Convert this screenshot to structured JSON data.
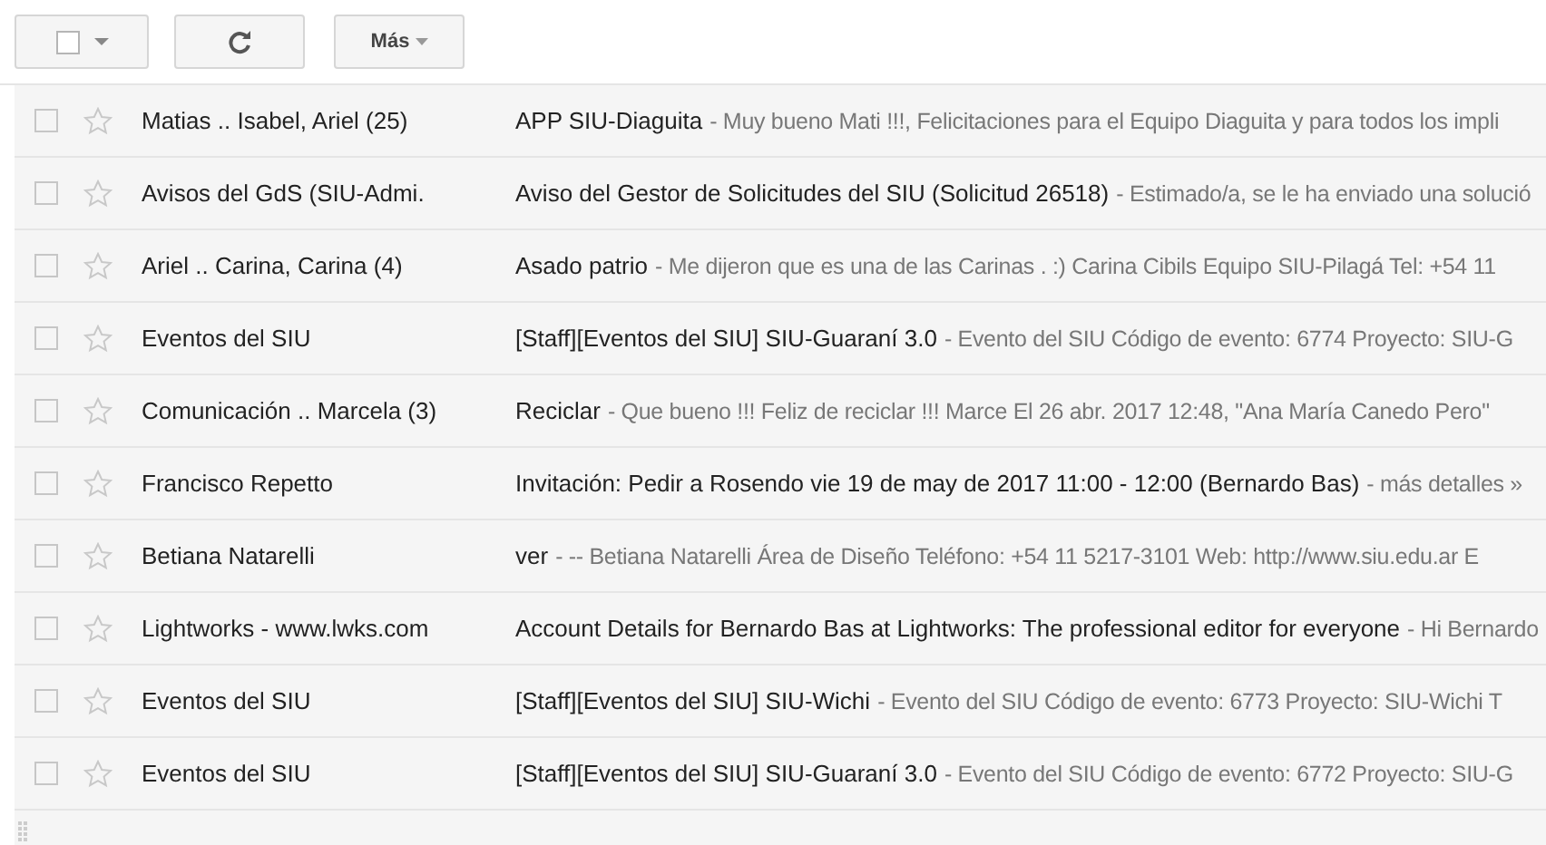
{
  "toolbar": {
    "select": {
      "checked": false
    },
    "more_label": "Más"
  },
  "emails": [
    {
      "sender": "Matias .. Isabel, Ariel (25)",
      "subject": "APP SIU-Diaguita",
      "snippet": "- Muy bueno Mati !!!, Felicitaciones para el Equipo Diaguita y para todos los impli",
      "checked": false,
      "starred": false
    },
    {
      "sender": "Avisos del GdS (SIU-Admi.",
      "subject": "Aviso del Gestor de Solicitudes del SIU (Solicitud 26518)",
      "snippet": "- Estimado/a, se le ha enviado una solució",
      "checked": false,
      "starred": false
    },
    {
      "sender": "Ariel .. Carina, Carina (4)",
      "subject": "Asado patrio",
      "snippet": "- Me dijeron que es una de las Carinas . :) Carina Cibils Equipo SIU-Pilagá Tel: +54 11",
      "checked": false,
      "starred": false
    },
    {
      "sender": "Eventos del SIU",
      "subject": "[Staff][Eventos del SIU] SIU-Guaraní 3.0",
      "snippet": "- Evento del SIU Código de evento: 6774 Proyecto: SIU-G",
      "checked": false,
      "starred": false
    },
    {
      "sender": "Comunicación .. Marcela (3)",
      "subject": "Reciclar",
      "snippet": "- Que bueno !!! Feliz de reciclar !!! Marce El 26 abr. 2017 12:48, \"Ana María Canedo Pero\"",
      "checked": false,
      "starred": false
    },
    {
      "sender": "Francisco Repetto",
      "subject": "Invitación: Pedir a Rosendo vie 19 de may de 2017 11:00 - 12:00 (Bernardo Bas)",
      "snippet": "- más detalles »",
      "checked": false,
      "starred": false
    },
    {
      "sender": "Betiana Natarelli",
      "subject": "ver",
      "snippet": "- -- Betiana Natarelli Área de Diseño Teléfono: +54 11 5217-3101 Web: http://www.siu.edu.ar E",
      "checked": false,
      "starred": false
    },
    {
      "sender": "Lightworks - www.lwks.com",
      "subject": "Account Details for Bernardo Bas at Lightworks: The professional editor for everyone",
      "snippet": "- Hi Bernardo",
      "checked": false,
      "starred": false
    },
    {
      "sender": "Eventos del SIU",
      "subject": "[Staff][Eventos del SIU] SIU-Wichi",
      "snippet": "- Evento del SIU Código de evento: 6773 Proyecto: SIU-Wichi T",
      "checked": false,
      "starred": false
    },
    {
      "sender": "Eventos del SIU",
      "subject": "[Staff][Eventos del SIU] SIU-Guaraní 3.0",
      "snippet": "- Evento del SIU Código de evento: 6772 Proyecto: SIU-G",
      "checked": false,
      "starred": false
    }
  ]
}
